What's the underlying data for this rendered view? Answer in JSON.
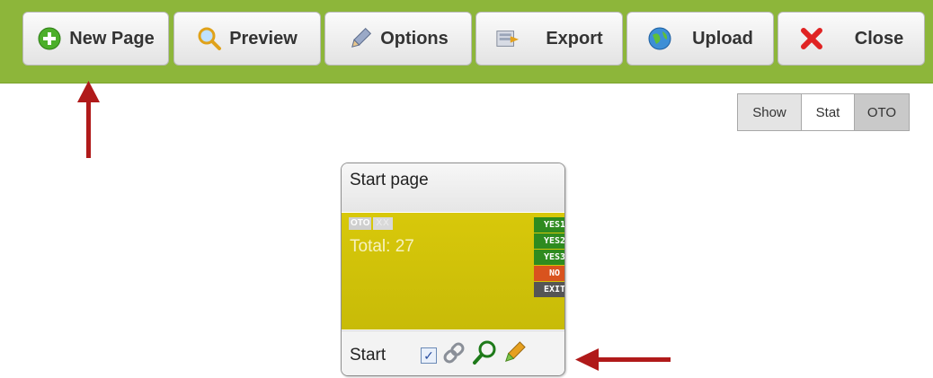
{
  "toolbar": {
    "buttons": [
      {
        "label": "New Page",
        "icon": "plus-circle-icon"
      },
      {
        "label": "Preview",
        "icon": "magnifier-icon"
      },
      {
        "label": "Options",
        "icon": "pencil-icon"
      },
      {
        "label": "Export",
        "icon": "export-icon"
      },
      {
        "label": "Upload",
        "icon": "globe-icon"
      },
      {
        "label": "Close",
        "icon": "close-icon"
      }
    ],
    "background": "#8db63a"
  },
  "view_toggle": {
    "items": [
      "Show",
      "Stat",
      "OTO"
    ],
    "selected": "Stat"
  },
  "card": {
    "title": "Start page",
    "tag_oto": "OTO",
    "tag_extra": "XX",
    "total": "Total: 27",
    "outputs": [
      {
        "label": "YES1",
        "color": "#2e8b1f"
      },
      {
        "label": "YES2",
        "color": "#2e8b1f"
      },
      {
        "label": "YES3",
        "color": "#2e8b1f"
      },
      {
        "label": "NO",
        "color": "#d9531e"
      },
      {
        "label": "EXIT",
        "color": "#555555"
      }
    ],
    "footer_label": "Start",
    "checkbox_checked": true,
    "body_color": "#d0c109"
  },
  "colors": {
    "arrow": "#b01a1a"
  }
}
